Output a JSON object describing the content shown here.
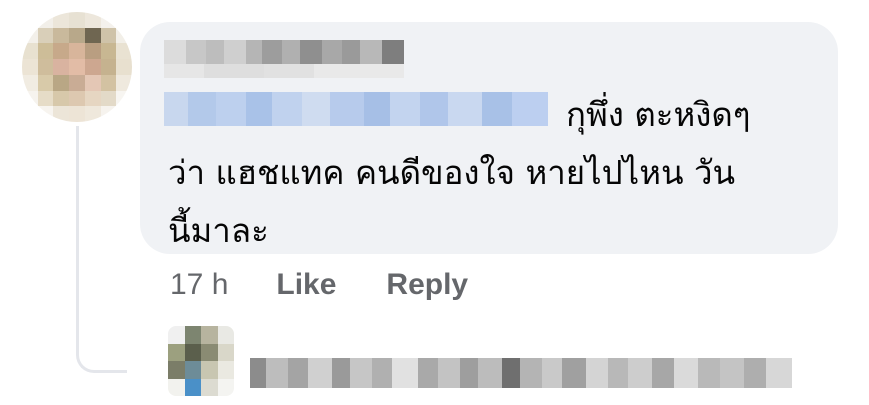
{
  "comment": {
    "text_line1": "กุพึ่ง ตะหงิดๆ",
    "text_line2": "ว่า แฮชแทค คนดีของใจ หายไปไหน วัน",
    "text_line3": "นี้มาละ"
  },
  "actions": {
    "time": "17 h",
    "like_label": "Like",
    "reply_label": "Reply"
  },
  "colors": {
    "bubble_bg": "#f0f2f5",
    "text": "#050505",
    "muted": "#65676b",
    "thread_line": "#e4e6eb"
  }
}
